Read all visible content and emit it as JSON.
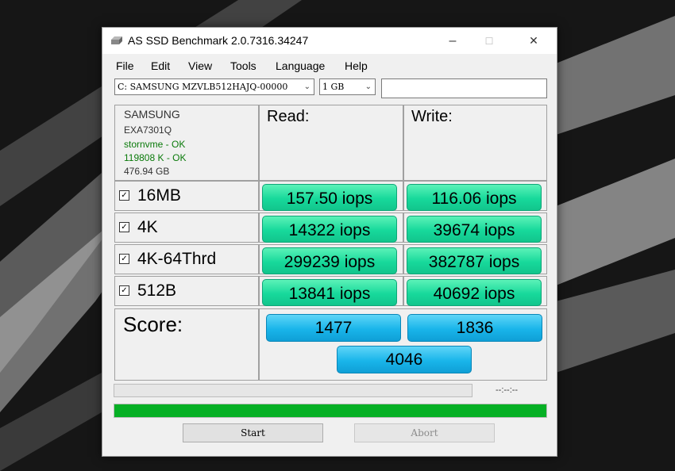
{
  "window": {
    "title": "AS SSD Benchmark 2.0.7316.34247",
    "minimize": "–",
    "maximize": "☐",
    "close": "✕"
  },
  "menu": [
    "File",
    "Edit",
    "View",
    "Tools",
    "Language",
    "Help"
  ],
  "drive_select": {
    "value": "C: SAMSUNG MZVLB512HAJQ-00000"
  },
  "size_select": {
    "value": "1 GB"
  },
  "drive_info": {
    "vendor": "SAMSUNG",
    "model": "EXA7301Q",
    "driver": "stornvme - OK",
    "alignment": "119808 K - OK",
    "capacity": "476.94 GB"
  },
  "headers": {
    "read": "Read:",
    "write": "Write:"
  },
  "rows": [
    {
      "label": "16MB",
      "read": "157.50 iops",
      "write": "116.06 iops"
    },
    {
      "label": "4K",
      "read": "14322 iops",
      "write": "39674 iops"
    },
    {
      "label": "4K-64Thrd",
      "read": "299239 iops",
      "write": "382787 iops"
    },
    {
      "label": "512B",
      "read": "13841 iops",
      "write": "40692 iops"
    }
  ],
  "score": {
    "label": "Score:",
    "read": "1477",
    "write": "1836",
    "total": "4046"
  },
  "progress": {
    "time": "--:--:--",
    "bottom_progress": 1.0
  },
  "buttons": {
    "start": "Start",
    "abort": "Abort"
  },
  "colors": {
    "result_green": "#17d99b",
    "score_blue": "#19b5ea",
    "progress_green": "#06b025"
  },
  "icons": {
    "app": "ssd-drive-icon",
    "checkbox": "checkbox-checked-icon"
  }
}
